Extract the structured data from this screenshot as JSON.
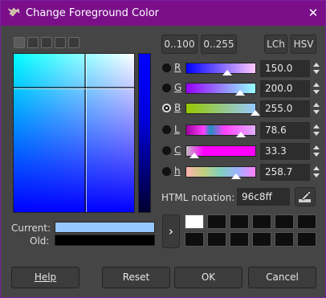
{
  "window": {
    "title": "Change Foreground Color"
  },
  "selectors": [
    {
      "icon": "gimp-selector-icon",
      "active": true
    },
    {
      "icon": "cmyk-selector-icon",
      "active": false
    },
    {
      "icon": "watercolor-selector-icon",
      "active": false
    },
    {
      "icon": "wheel-selector-icon",
      "active": false
    },
    {
      "icon": "palette-selector-icon",
      "active": false
    }
  ],
  "ranges": {
    "range_0_100": "0..100",
    "range_0_255": "0..255"
  },
  "models": {
    "lch": "LCh",
    "hsv": "HSV"
  },
  "channels": [
    {
      "label": "R",
      "value": "150.0",
      "fraction": 0.588,
      "selected": false,
      "gradient": "linear-gradient(to right,#0000ff,#ffc8ff)"
    },
    {
      "label": "G",
      "value": "200.0",
      "fraction": 0.784,
      "selected": false,
      "gradient": "linear-gradient(to right,#9600ff,#96ffff)"
    },
    {
      "label": "B",
      "value": "255.0",
      "fraction": 1.0,
      "selected": true,
      "gradient": "linear-gradient(to right,#96c800,#96c8ff)"
    },
    {
      "label": "L",
      "value": "78.6",
      "fraction": 0.786,
      "selected": false,
      "gradient": "linear-gradient(to right,#a000a0 0%,#ff40ff 25%,#1e90c0 35%,#ff40ff 55%,#e0b0ff 100%)"
    },
    {
      "label": "C",
      "value": "33.3",
      "fraction": 0.12,
      "selected": false,
      "gradient": "linear-gradient(to right,#c0c0c0 0%,#ff00ff 25%,#ff00ff 100%)"
    },
    {
      "label": "h",
      "value": "258.7",
      "fraction": 0.72,
      "selected": false,
      "gradient": "linear-gradient(to right,#ffb0b0,#c0d080,#80d0c0,#a0b0ff,#ff80ff)"
    }
  ],
  "html_notation": {
    "label": "HTML notation:",
    "value": "96c8ff"
  },
  "swatches": {
    "current_label": "Current:",
    "old_label": "Old:",
    "current_color": "#96c8ff",
    "old_color": "#000000"
  },
  "history": {
    "arrow": "›",
    "colors": [
      "#ffffff",
      "#0e0e0e",
      "#0e0e0e",
      "#0e0e0e",
      "#0e0e0e",
      "#0e0e0e",
      "#0e0e0e",
      "#0e0e0e",
      "#0e0e0e",
      "#0e0e0e",
      "#0e0e0e",
      "#0e0e0e"
    ]
  },
  "buttons": {
    "help": "Help",
    "reset": "Reset",
    "ok": "OK",
    "cancel": "Cancel"
  },
  "colors": {
    "titlebar": "#7b0f8a",
    "background": "#454545",
    "accent_border": "#7a1fa0"
  }
}
